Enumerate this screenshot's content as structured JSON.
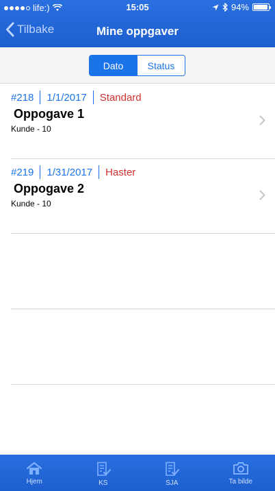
{
  "status_bar": {
    "carrier": "life:)",
    "time": "15:05",
    "battery": "94%",
    "battery_level": 0.94
  },
  "nav": {
    "back_label": "Tilbake",
    "title": "Mine oppgaver"
  },
  "segment": {
    "options": [
      "Dato",
      "Status"
    ],
    "selected": "Dato"
  },
  "tasks": [
    {
      "id": "#218",
      "date": "1/1/2017",
      "priority": "Standard",
      "title": "Oppogave 1",
      "customer": "Kunde - 10"
    },
    {
      "id": "#219",
      "date": "1/31/2017",
      "priority": "Haster",
      "title": "Oppogave 2",
      "customer": "Kunde - 10"
    }
  ],
  "tabs": [
    {
      "label": "Hjem",
      "icon": "home-icon"
    },
    {
      "label": "KS",
      "icon": "checklist-icon"
    },
    {
      "label": "SJA",
      "icon": "checklist-icon"
    },
    {
      "label": "Ta bilde",
      "icon": "camera-icon"
    }
  ],
  "colors": {
    "brand_blue": "#1d5fcf",
    "accent_blue": "#1a73e8",
    "priority_red": "#d03030"
  }
}
